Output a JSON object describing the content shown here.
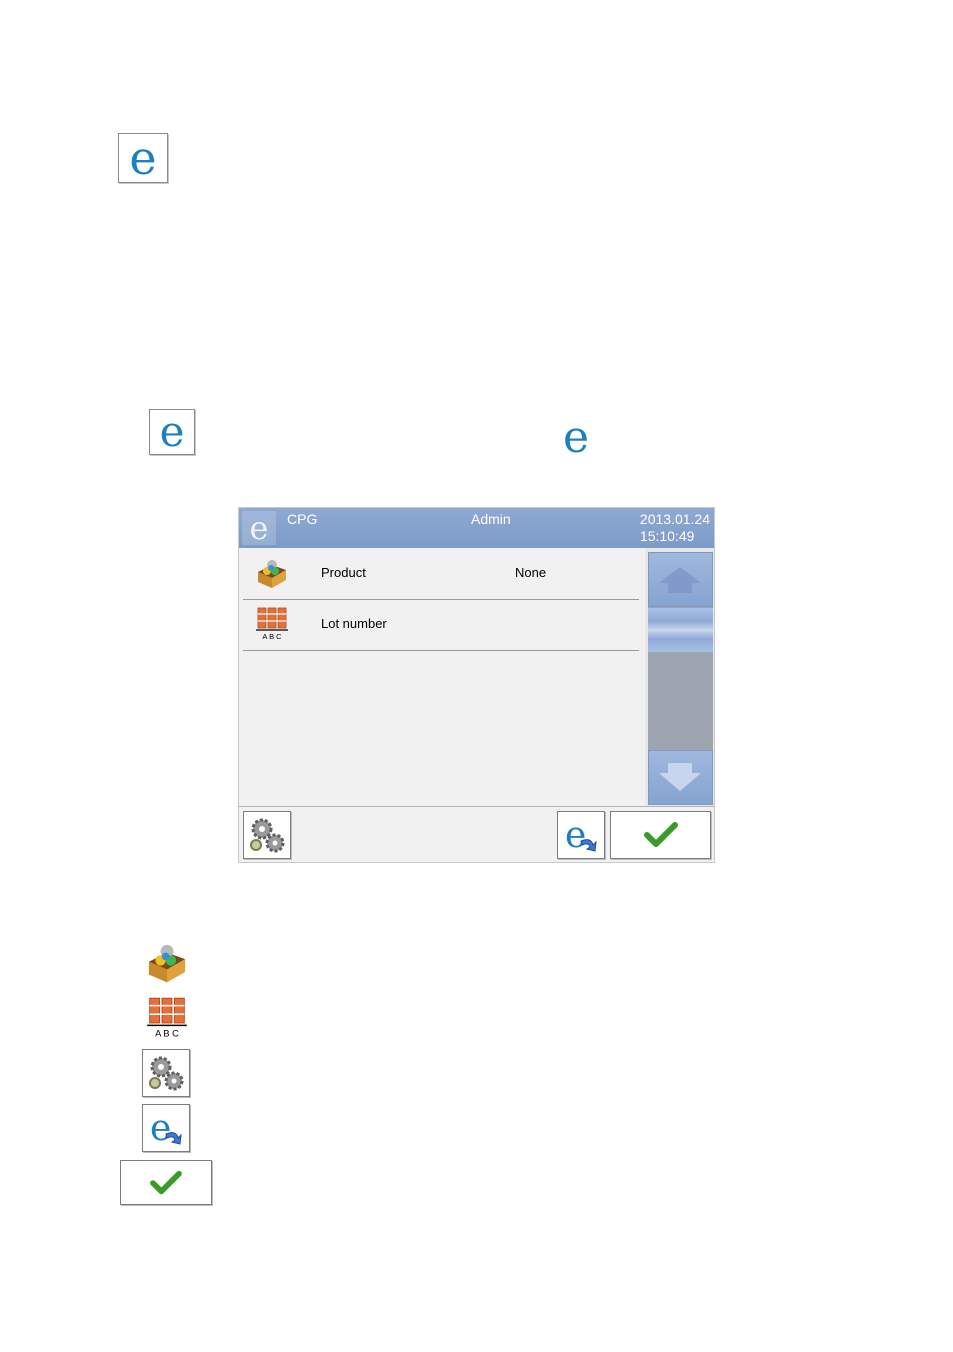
{
  "logos": {
    "letter": "e"
  },
  "titlebar": {
    "app": "CPG",
    "user": "Admin",
    "date": "2013.01.24",
    "time": "15:10:49"
  },
  "rows": [
    {
      "label": "Product",
      "value": "None",
      "icon": "product-box-icon"
    },
    {
      "label": "Lot number",
      "value": "",
      "icon": "lot-number-abc-icon"
    }
  ],
  "lot_icon_caption": "A B C",
  "buttons": {
    "settings_icon": "gears-icon",
    "exit_icon": "exit-e-arrow-icon",
    "ok_icon": "green-checkmark-icon"
  },
  "colors": {
    "titlebar": "#7d9bc8",
    "logo_blue": "#1a7fc4",
    "check_green": "#3a9a2a",
    "lot_orange": "#e4703a"
  }
}
